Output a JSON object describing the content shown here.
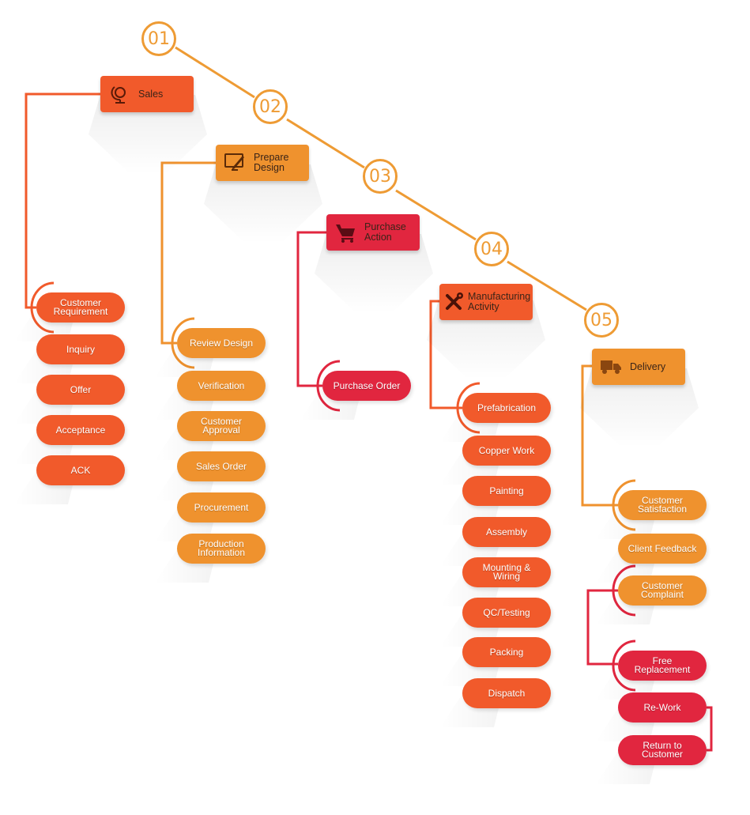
{
  "colors": {
    "red_orange": "#f15a2b",
    "orange": "#ef922e",
    "crimson": "#e1263f",
    "step_line": "#ee9b34"
  },
  "steps": [
    "01",
    "02",
    "03",
    "04",
    "05"
  ],
  "stages": [
    {
      "title": "Sales",
      "icon": "globe-icon",
      "color": "red_orange",
      "items": [
        "Customer Requirement",
        "Inquiry",
        "Offer",
        "Acceptance",
        "ACK"
      ]
    },
    {
      "title": "Prepare Design",
      "icon": "monitor-pen-icon",
      "color": "orange",
      "items": [
        "Review Design",
        "Verification",
        "Customer Approval",
        "Sales Order",
        "Procurement",
        "Production Information"
      ]
    },
    {
      "title": "Purchase Action",
      "icon": "cart-icon",
      "color": "crimson",
      "items": [
        "Purchase Order"
      ]
    },
    {
      "title": "Manufacturing Activity",
      "icon": "tools-icon",
      "color": "red_orange",
      "items": [
        "Prefabrication",
        "Copper Work",
        "Painting",
        "Assembly",
        "Mounting & Wiring",
        "QC/Testing",
        "Packing",
        "Dispatch"
      ]
    },
    {
      "title": "Delivery",
      "icon": "truck-icon",
      "color": "orange",
      "items": [
        "Customer Satisfaction",
        "Client Feedback",
        "Customer Complaint"
      ],
      "complaint_items": [
        "Free Replacement",
        "Re-Work",
        "Return to Customer"
      ]
    }
  ]
}
